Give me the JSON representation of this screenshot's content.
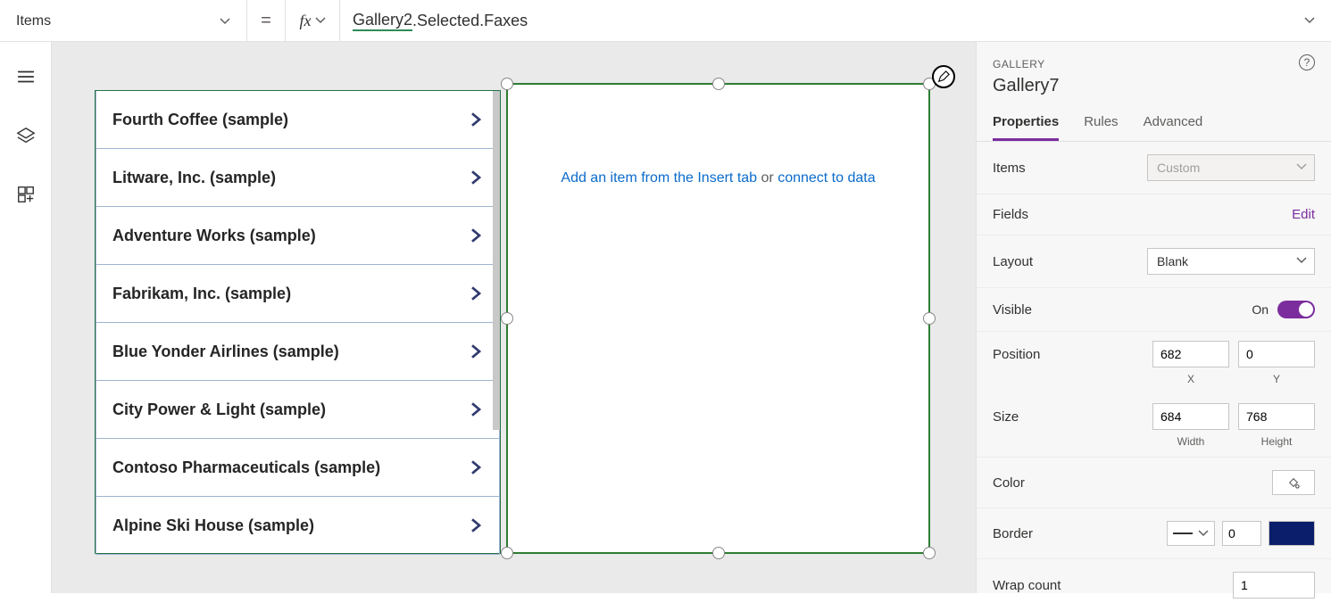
{
  "formula_bar": {
    "property_dropdown": "Items",
    "equals": "=",
    "fx_label": "fx",
    "formula_ref": "Gallery2",
    "formula_rest": ".Selected.Faxes"
  },
  "left_rail": {
    "icons": [
      "menu-icon",
      "layers-icon",
      "tiles-icon"
    ]
  },
  "gallery_list": {
    "items": [
      "Fourth Coffee (sample)",
      "Litware, Inc. (sample)",
      "Adventure Works (sample)",
      "Fabrikam, Inc. (sample)",
      "Blue Yonder Airlines (sample)",
      "City Power & Light (sample)",
      "Contoso Pharmaceuticals (sample)",
      "Alpine Ski House (sample)"
    ]
  },
  "selected_gallery": {
    "hint_link_left": "Add an item from the Insert tab",
    "hint_or": " or ",
    "hint_link_right": "connect to data"
  },
  "panel": {
    "type": "GALLERY",
    "name": "Gallery7",
    "help": "?",
    "tabs": {
      "properties": "Properties",
      "rules": "Rules",
      "advanced": "Advanced"
    },
    "items_label": "Items",
    "items_value": "Custom",
    "fields_label": "Fields",
    "fields_edit": "Edit",
    "layout_label": "Layout",
    "layout_value": "Blank",
    "visible_label": "Visible",
    "visible_state": "On",
    "position_label": "Position",
    "position_x": "682",
    "position_y": "0",
    "position_x_label": "X",
    "position_y_label": "Y",
    "size_label": "Size",
    "size_w": "684",
    "size_h": "768",
    "size_w_label": "Width",
    "size_h_label": "Height",
    "color_label": "Color",
    "border_label": "Border",
    "border_value": "0",
    "wrap_label": "Wrap count",
    "wrap_value": "1",
    "border_color": "#0b1e6b"
  }
}
